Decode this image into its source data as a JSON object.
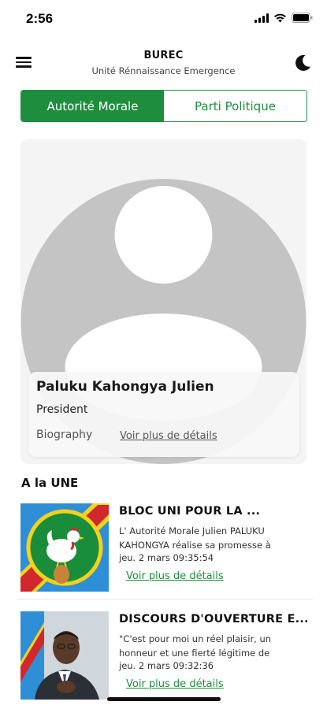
{
  "status": {
    "time": "2:56",
    "icons": [
      "signal-icon",
      "wifi-icon",
      "battery-icon"
    ]
  },
  "header": {
    "title": "BUREC",
    "subtitle": "Unité Rénnaissance Emergence",
    "menu_icon": "hamburger-menu-icon",
    "theme_icon": "moon-icon"
  },
  "tabs": [
    {
      "label": "Autorité Morale",
      "active": true
    },
    {
      "label": "Parti Politique",
      "active": false
    }
  ],
  "profile": {
    "name": "Paluku Kahongya Julien",
    "role": "President",
    "bio_label": "Biography",
    "details_link": "Voir plus de détails"
  },
  "section": {
    "title": "A la UNE"
  },
  "news": [
    {
      "title": "BLOC UNI POUR LA ...",
      "excerpt": "L' Autorité Morale Julien PALUKU KAHONGYA réalise sa promesse à",
      "date": "jeu. 2 mars 09:35:54",
      "link": "Voir plus de détails"
    },
    {
      "title": "DISCOURS D'OUVERTURE E...",
      "excerpt": "\"C'est pour moi un réel plaisir, un honneur et une fierté légitime de",
      "date": "jeu. 2 mars 09:32:36",
      "link": "Voir plus de détails"
    }
  ],
  "colors": {
    "accent": "#1e8e3e",
    "avatar_gray": "#c4c4c4"
  }
}
